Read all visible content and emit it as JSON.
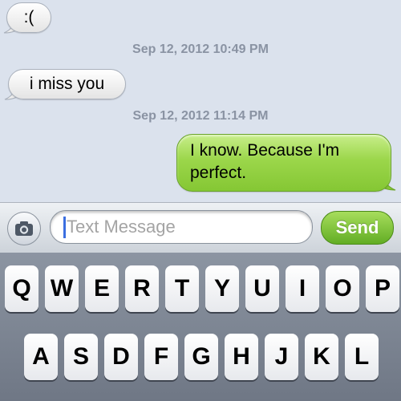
{
  "messages": [
    {
      "direction": "incoming",
      "text": ":("
    },
    {
      "timestamp": "Sep 12, 2012 10:49 PM"
    },
    {
      "direction": "incoming",
      "text": "i miss you"
    },
    {
      "timestamp": "Sep 12, 2012 11:14 PM"
    },
    {
      "direction": "outgoing",
      "text": "I know. Because I'm perfect."
    }
  ],
  "input": {
    "placeholder": "Text Message",
    "value": "",
    "send_label": "Send",
    "camera_icon": "camera-icon"
  },
  "keyboard": {
    "row1": [
      "Q",
      "W",
      "E",
      "R",
      "T",
      "Y",
      "U",
      "I",
      "O",
      "P"
    ],
    "row2": [
      "A",
      "S",
      "D",
      "F",
      "G",
      "H",
      "J",
      "K",
      "L"
    ]
  },
  "colors": {
    "thread_background": "#dbe2ed",
    "outgoing_bubble": "#9bd64a",
    "incoming_bubble": "#ffffff",
    "send_button": "#62ad24",
    "cursor": "#3c6fe0"
  }
}
